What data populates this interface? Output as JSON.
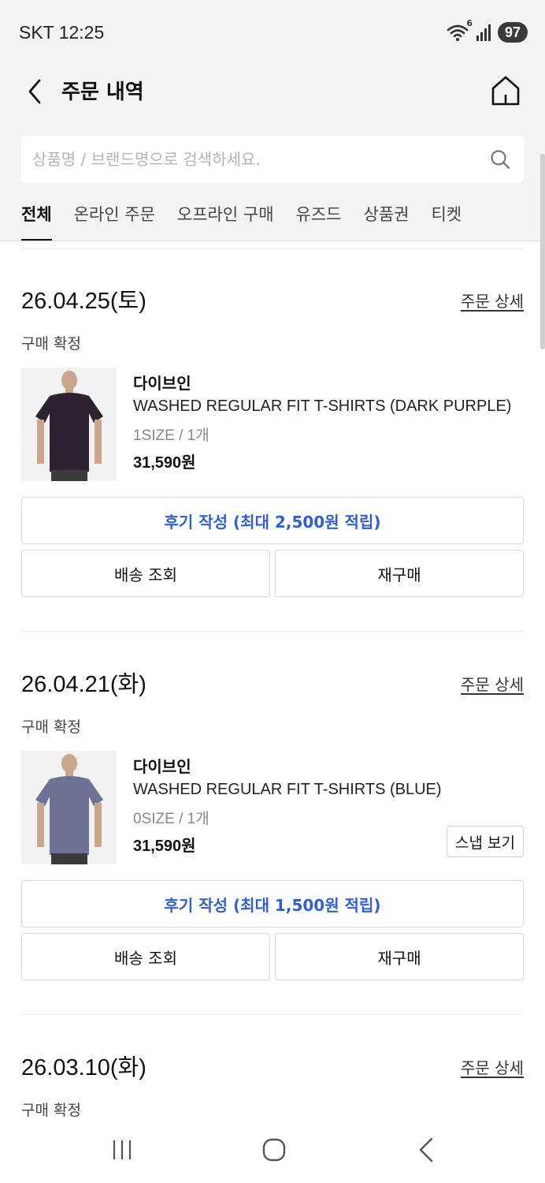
{
  "status_bar": {
    "carrier_time": "SKT 12:25",
    "battery": "97",
    "wifi_badge": "6"
  },
  "header": {
    "title": "주문 내역"
  },
  "search": {
    "placeholder": "상품명 / 브랜드명으로 검색하세요."
  },
  "tabs": [
    "전체",
    "온라인 주문",
    "오프라인 구매",
    "유즈드",
    "상품권",
    "티켓"
  ],
  "active_tab": "전체",
  "orders": [
    {
      "date": "26.04.25(토)",
      "detail_label": "주문 상세",
      "status": "구매 확정",
      "brand": "다이브인",
      "product_name": "WASHED REGULAR FIT T-SHIRTS (DARK PURPLE)",
      "option": "1SIZE / 1개",
      "price": "31,590원",
      "shirt_color": "#2c2231",
      "review_label": "후기 작성 (최대 2,500원 적립)",
      "delivery_label": "배송 조회",
      "reorder_label": "재구매"
    },
    {
      "date": "26.04.21(화)",
      "detail_label": "주문 상세",
      "status": "구매 확정",
      "brand": "다이브인",
      "product_name": "WASHED REGULAR FIT T-SHIRTS (BLUE)",
      "option": "0SIZE / 1개",
      "price": "31,590원",
      "snap_label": "스냅 보기",
      "shirt_color": "#6e7396",
      "review_label": "후기 작성 (최대 1,500원 적립)",
      "delivery_label": "배송 조회",
      "reorder_label": "재구매"
    },
    {
      "date": "26.03.10(화)",
      "detail_label": "주문 상세",
      "status": "구매 확정"
    }
  ],
  "colors": {
    "accent": "#2f5fd0",
    "top_background": "#f3f3f3"
  }
}
